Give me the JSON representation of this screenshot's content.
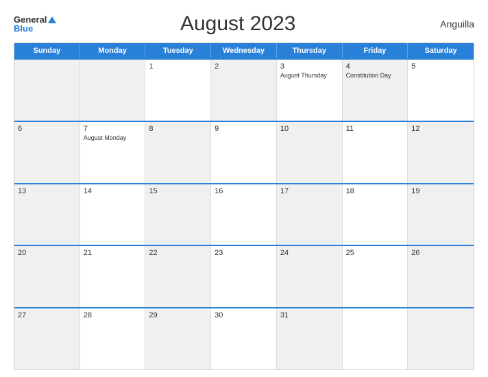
{
  "header": {
    "logo_general": "General",
    "logo_blue": "Blue",
    "title": "August 2023",
    "country": "Anguilla"
  },
  "weekdays": [
    "Sunday",
    "Monday",
    "Tuesday",
    "Wednesday",
    "Thursday",
    "Friday",
    "Saturday"
  ],
  "weeks": [
    [
      {
        "day": "",
        "event": "",
        "shaded": true
      },
      {
        "day": "",
        "event": "",
        "shaded": true
      },
      {
        "day": "1",
        "event": "",
        "shaded": false
      },
      {
        "day": "2",
        "event": "",
        "shaded": true
      },
      {
        "day": "3",
        "event": "August Thursday",
        "shaded": false
      },
      {
        "day": "4",
        "event": "Constitution Day",
        "shaded": true
      },
      {
        "day": "5",
        "event": "",
        "shaded": false
      }
    ],
    [
      {
        "day": "6",
        "event": "",
        "shaded": true
      },
      {
        "day": "7",
        "event": "August Monday",
        "shaded": false
      },
      {
        "day": "8",
        "event": "",
        "shaded": true
      },
      {
        "day": "9",
        "event": "",
        "shaded": false
      },
      {
        "day": "10",
        "event": "",
        "shaded": true
      },
      {
        "day": "11",
        "event": "",
        "shaded": false
      },
      {
        "day": "12",
        "event": "",
        "shaded": true
      }
    ],
    [
      {
        "day": "13",
        "event": "",
        "shaded": true
      },
      {
        "day": "14",
        "event": "",
        "shaded": false
      },
      {
        "day": "15",
        "event": "",
        "shaded": true
      },
      {
        "day": "16",
        "event": "",
        "shaded": false
      },
      {
        "day": "17",
        "event": "",
        "shaded": true
      },
      {
        "day": "18",
        "event": "",
        "shaded": false
      },
      {
        "day": "19",
        "event": "",
        "shaded": true
      }
    ],
    [
      {
        "day": "20",
        "event": "",
        "shaded": true
      },
      {
        "day": "21",
        "event": "",
        "shaded": false
      },
      {
        "day": "22",
        "event": "",
        "shaded": true
      },
      {
        "day": "23",
        "event": "",
        "shaded": false
      },
      {
        "day": "24",
        "event": "",
        "shaded": true
      },
      {
        "day": "25",
        "event": "",
        "shaded": false
      },
      {
        "day": "26",
        "event": "",
        "shaded": true
      }
    ],
    [
      {
        "day": "27",
        "event": "",
        "shaded": true
      },
      {
        "day": "28",
        "event": "",
        "shaded": false
      },
      {
        "day": "29",
        "event": "",
        "shaded": true
      },
      {
        "day": "30",
        "event": "",
        "shaded": false
      },
      {
        "day": "31",
        "event": "",
        "shaded": true
      },
      {
        "day": "",
        "event": "",
        "shaded": false
      },
      {
        "day": "",
        "event": "",
        "shaded": true
      }
    ]
  ]
}
